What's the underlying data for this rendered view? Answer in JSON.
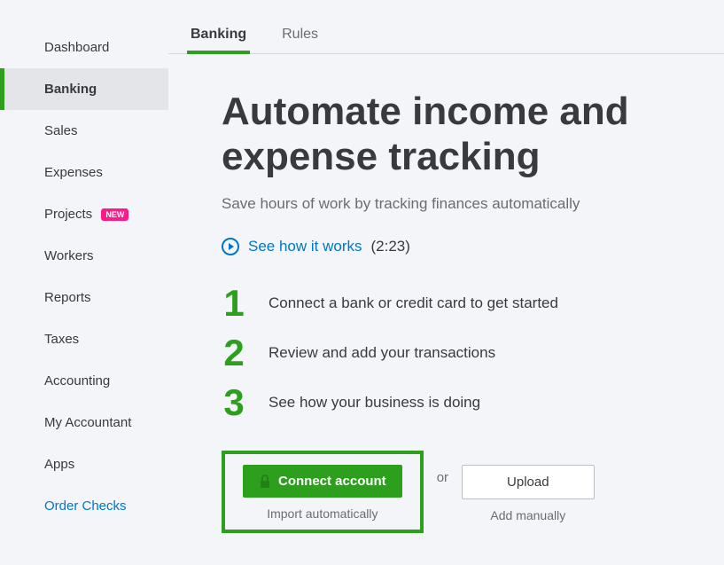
{
  "sidebar": {
    "items": [
      {
        "label": "Dashboard"
      },
      {
        "label": "Banking"
      },
      {
        "label": "Sales"
      },
      {
        "label": "Expenses"
      },
      {
        "label": "Projects",
        "badge": "NEW"
      },
      {
        "label": "Workers"
      },
      {
        "label": "Reports"
      },
      {
        "label": "Taxes"
      },
      {
        "label": "Accounting"
      },
      {
        "label": "My Accountant"
      },
      {
        "label": "Apps"
      },
      {
        "label": "Order Checks"
      }
    ]
  },
  "tabs": [
    {
      "label": "Banking"
    },
    {
      "label": "Rules"
    }
  ],
  "hero": {
    "title": "Automate income and expense tracking",
    "subtitle": "Save hours of work by tracking finances automatically",
    "video_link": "See how it works",
    "video_duration": "(2:23)"
  },
  "steps": [
    {
      "num": "1",
      "text": "Connect a bank or credit card to get started"
    },
    {
      "num": "2",
      "text": "Review and add your transactions"
    },
    {
      "num": "3",
      "text": "See how your business is doing"
    }
  ],
  "actions": {
    "connect_label": "Connect account",
    "connect_sub": "Import automatically",
    "or": "or",
    "upload_label": "Upload",
    "upload_sub": "Add manually"
  }
}
